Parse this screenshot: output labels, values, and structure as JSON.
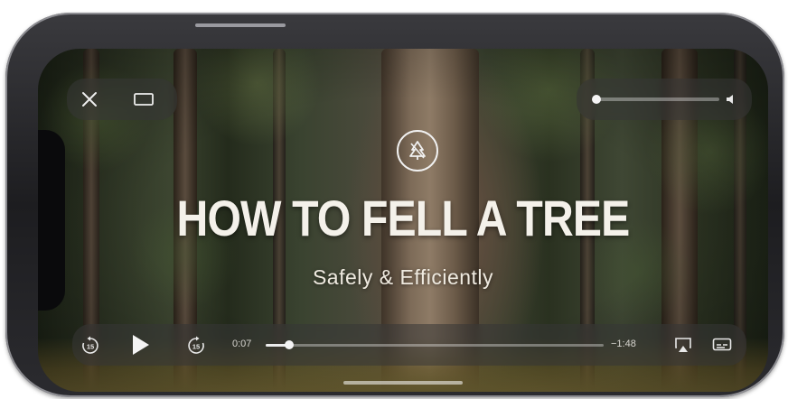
{
  "video": {
    "title": "HOW TO FELL A TREE",
    "subtitle": "Safely & Efficiently",
    "logo_icon": "tree-emblem-icon"
  },
  "top_controls": {
    "close_icon": "close-icon",
    "pip_icon": "picture-in-picture-icon",
    "volume_level": 0.03,
    "speaker_icon": "speaker-icon"
  },
  "playback": {
    "skip_back_icon": "skip-back-15-icon",
    "skip_back_seconds": "15",
    "play_icon": "play-icon",
    "skip_forward_icon": "skip-forward-15-icon",
    "skip_forward_seconds": "15",
    "elapsed": "0:07",
    "remaining": "−1:48",
    "progress": 0.07,
    "airplay_icon": "airplay-icon",
    "subtitles_icon": "subtitles-icon"
  },
  "colors": {
    "control_pill": "#373737",
    "text": "#f4f1ea"
  }
}
